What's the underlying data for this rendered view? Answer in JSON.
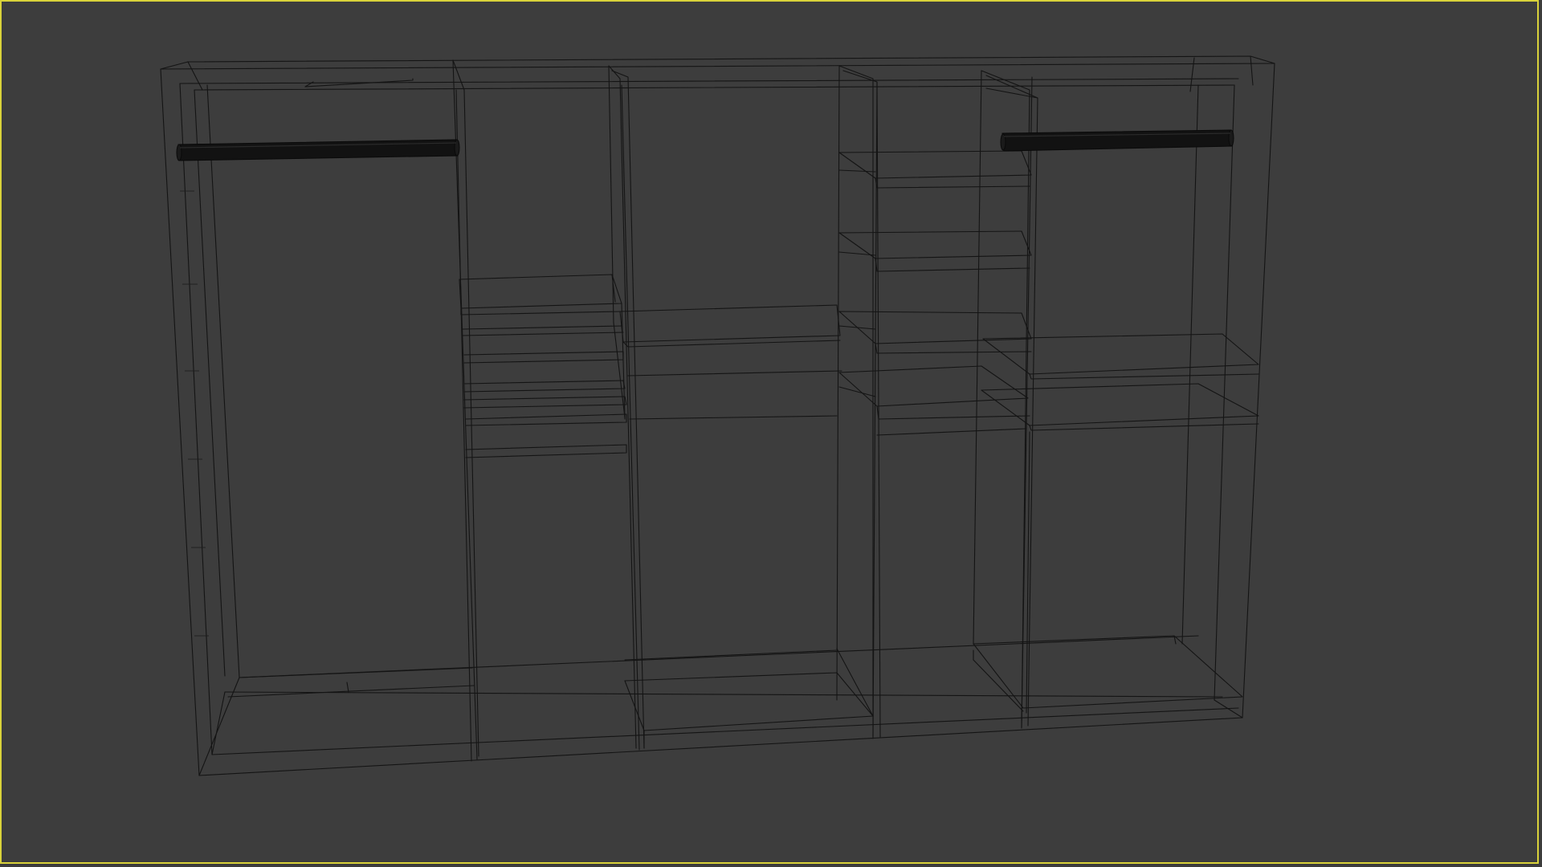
{
  "viewport": {
    "active_border_color": "#d9d23a",
    "background_color": "#3d3d3d",
    "wire_color": "#141414",
    "rod_color": "#121212",
    "model": "wardrobe-wireframe"
  }
}
